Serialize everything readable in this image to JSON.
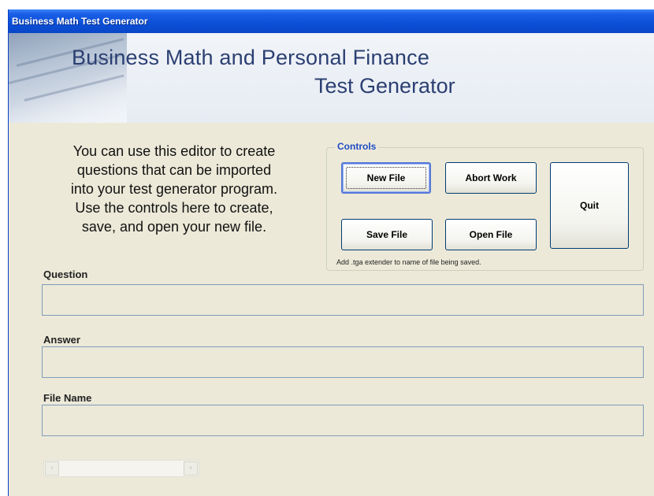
{
  "window": {
    "title": "Business Math Test Generator"
  },
  "banner": {
    "line1": "Business Math and Personal Finance",
    "line2": "Test Generator"
  },
  "intro": {
    "lines": [
      "You can use this editor to create",
      "questions that can be imported",
      "into your test generator program.",
      "Use the controls here to create,",
      "save, and open your new file."
    ]
  },
  "controls": {
    "label": "Controls",
    "new_file": "New File",
    "abort_work": "Abort Work",
    "quit": "Quit",
    "save_file": "Save File",
    "open_file": "Open File",
    "hint": "Add .tga extender to name of file being saved."
  },
  "fields": {
    "question_label": "Question",
    "question_value": "",
    "answer_label": "Answer",
    "answer_value": "",
    "filename_label": "File Name",
    "filename_value": ""
  },
  "scrollbar": {
    "left_arrow": "‹",
    "right_arrow": "›"
  }
}
